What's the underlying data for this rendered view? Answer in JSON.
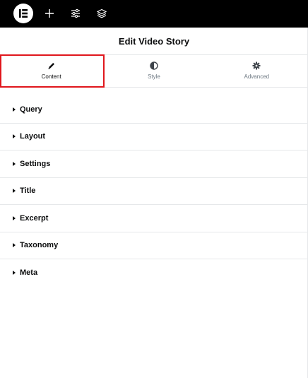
{
  "topbar": {
    "icons": [
      "elementor-logo-icon",
      "plus-icon",
      "sliders-icon",
      "layers-icon"
    ],
    "colors": {
      "bg": "#000000",
      "fg": "#ffffff"
    }
  },
  "header": {
    "title": "Edit Video Story"
  },
  "tabs": [
    {
      "label": "Content",
      "icon": "pencil-icon",
      "active": true
    },
    {
      "label": "Style",
      "icon": "half-circle-icon",
      "active": false
    },
    {
      "label": "Advanced",
      "icon": "gear-icon",
      "active": false
    }
  ],
  "highlight_color": "#e0161c",
  "sections": [
    {
      "label": "Query"
    },
    {
      "label": "Layout"
    },
    {
      "label": "Settings"
    },
    {
      "label": "Title"
    },
    {
      "label": "Excerpt"
    },
    {
      "label": "Taxonomy"
    },
    {
      "label": "Meta"
    }
  ]
}
